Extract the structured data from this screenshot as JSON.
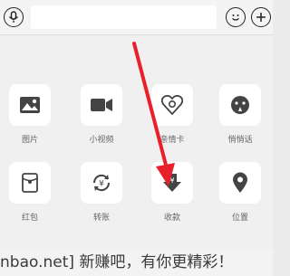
{
  "input_bar": {
    "text_input_value": "",
    "icons": {
      "voice": "microphone-icon",
      "emoji": "smile-icon",
      "more": "plus-icon"
    }
  },
  "tools": [
    {
      "label": "图片",
      "icon": "image-icon"
    },
    {
      "label": "小视频",
      "icon": "video-camera-icon"
    },
    {
      "label": "亲情卡",
      "icon": "heart-card-icon"
    },
    {
      "label": "悄悄话",
      "icon": "whisper-icon"
    },
    {
      "label": "红包",
      "icon": "red-packet-icon"
    },
    {
      "label": "转账",
      "icon": "transfer-icon"
    },
    {
      "label": "收款",
      "icon": "receive-money-icon"
    },
    {
      "label": "位置",
      "icon": "location-pin-icon"
    }
  ],
  "overlay": {
    "watermark_text": "nbao.net] 新赚吧，有你更精彩！",
    "arrow_color": "#e8202a"
  }
}
